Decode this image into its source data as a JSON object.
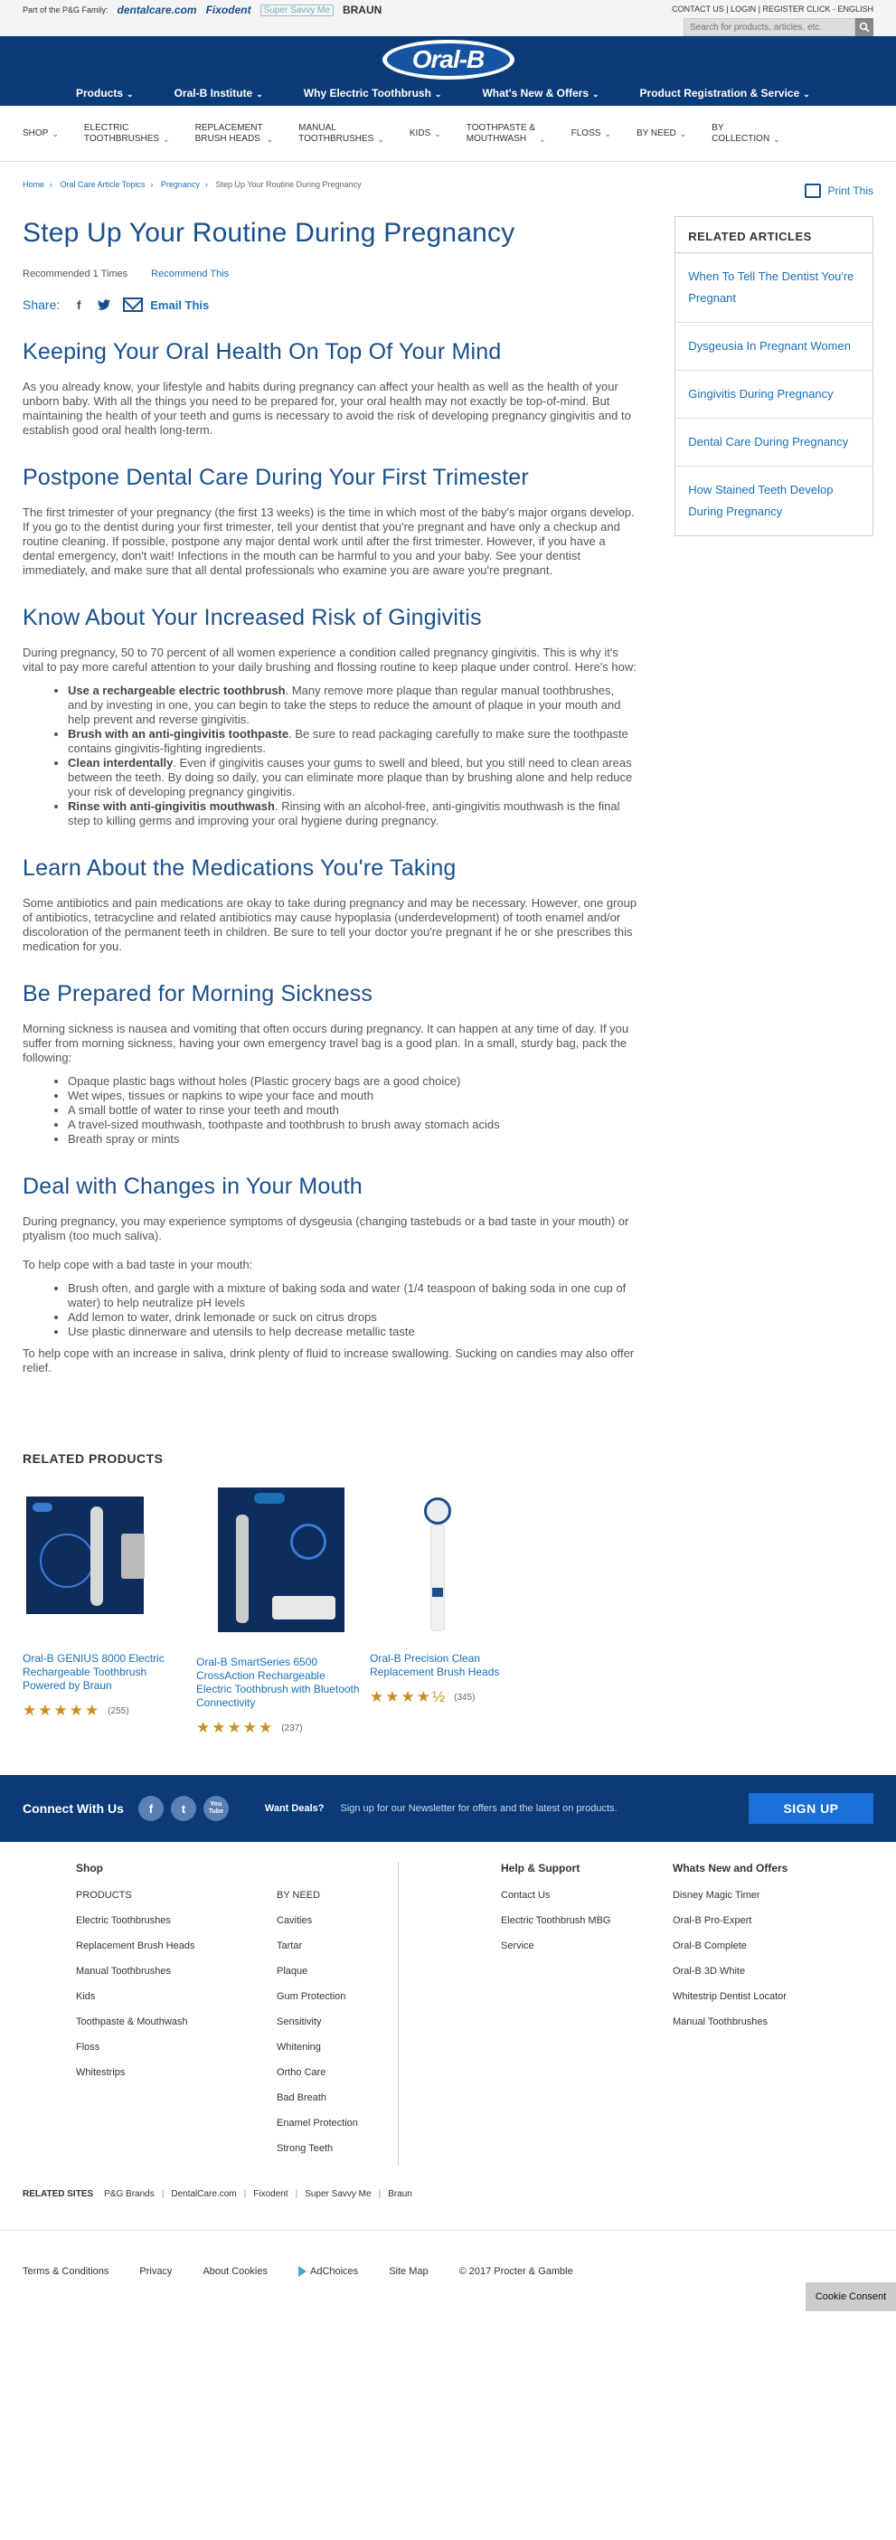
{
  "utility": {
    "family_label": "Part of the P&G Family:",
    "brands": [
      "dentalcare.com",
      "Fixodent",
      "Super Savvy Me",
      "BRAUN"
    ],
    "links": "CONTACT US | LOGIN | REGISTER   CLICK - ENGLISH",
    "search_placeholder": "Search for products, articles, etc."
  },
  "logo": "Oral-B",
  "main_nav": [
    "Products",
    "Oral-B Institute",
    "Why Electric Toothbrush",
    "What's New & Offers",
    "Product Registration & Service"
  ],
  "sub_nav": [
    {
      "l1": "SHOP",
      "l2": ""
    },
    {
      "l1": "ELECTRIC",
      "l2": "TOOTHBRUSHES"
    },
    {
      "l1": "REPLACEMENT",
      "l2": "BRUSH HEADS"
    },
    {
      "l1": "MANUAL",
      "l2": "TOOTHBRUSHES"
    },
    {
      "l1": "KIDS",
      "l2": ""
    },
    {
      "l1": "TOOTHPASTE &",
      "l2": "MOUTHWASH"
    },
    {
      "l1": "FLOSS",
      "l2": ""
    },
    {
      "l1": "BY NEED",
      "l2": ""
    },
    {
      "l1": "BY",
      "l2": "COLLECTION"
    }
  ],
  "breadcrumb": [
    "Home",
    "Oral Care Article Topics",
    "Pregnancy",
    "Step Up Your Routine During Pregnancy"
  ],
  "print_label": "Print This",
  "article": {
    "title": "Step Up Your Routine During Pregnancy",
    "recommended": "Recommended 1 Times",
    "recommend_this": "Recommend This",
    "share_label": "Share:",
    "email_this": "Email This",
    "s1_h": "Keeping Your Oral Health On Top Of Your Mind",
    "s1_p": "As you already know, your lifestyle and habits during pregnancy can affect your health as well as the health of your unborn baby. With all the things you need to be prepared for, your oral health may not exactly be top-of-mind. But maintaining the health of your teeth and gums is necessary to avoid the risk of developing pregnancy gingivitis and to establish good oral health long-term.",
    "s2_h": "Postpone Dental Care During Your First Trimester",
    "s2_p": "The first trimester of your pregnancy (the first 13 weeks) is the time in which most of the baby's major organs develop. If you go to the dentist during your first trimester, tell your dentist that you're pregnant and have only a checkup and routine cleaning. If possible, postpone any major dental work until after the first trimester. However, if you have a dental emergency, don't wait! Infections in the mouth can be harmful to you and your baby. See your dentist immediately, and make sure that all dental professionals who examine you are aware you're pregnant.",
    "s3_h": "Know About Your Increased Risk of Gingivitis",
    "s3_p": "During pregnancy, 50 to 70 percent of all women experience a condition called pregnancy gingivitis. This is why it's vital to pay more careful attention to your daily brushing and flossing routine to keep plaque under control. Here's how:",
    "s3_list": [
      {
        "b": "Use a rechargeable electric toothbrush",
        "t": ". Many remove more plaque than regular manual toothbrushes, and by investing in one, you can begin to take the steps to reduce the amount of plaque in your mouth and help prevent and reverse gingivitis."
      },
      {
        "b": "Brush with an anti-gingivitis toothpaste",
        "t": ". Be sure to read packaging carefully to make sure the toothpaste contains gingivitis-fighting ingredients."
      },
      {
        "b": "Clean interdentally",
        "t": ". Even if gingivitis causes your gums to swell and bleed, but you still need to clean areas between the teeth. By doing so daily, you can eliminate more plaque than by brushing alone and help reduce your risk of developing pregnancy gingivitis."
      },
      {
        "b": "Rinse with anti-gingivitis mouthwash",
        "t": ". Rinsing with an alcohol-free, anti-gingivitis mouthwash is the final step to killing germs and improving your oral hygiene during pregnancy."
      }
    ],
    "s4_h": "Learn About the Medications You're Taking",
    "s4_p": "Some antibiotics and pain medications are okay to take during pregnancy and may be necessary. However, one group of antibiotics, tetracycline and related antibiotics may cause hypoplasia (underdevelopment) of tooth enamel and/or discoloration of the permanent teeth in children. Be sure to tell your doctor you're pregnant if he or she prescribes this medication for you.",
    "s5_h": "Be Prepared for Morning Sickness",
    "s5_p": "Morning sickness is nausea and vomiting that often occurs during pregnancy. It can happen at any time of day. If you suffer from morning sickness, having your own emergency travel bag is a good plan. In a small, sturdy bag, pack the following:",
    "s5_list": [
      "Opaque plastic bags without holes (Plastic grocery bags are a good choice)",
      "Wet wipes, tissues or napkins to wipe your face and mouth",
      "A small bottle of water to rinse your teeth and mouth",
      "A travel-sized mouthwash, toothpaste and toothbrush to brush away stomach acids",
      "Breath spray or mints"
    ],
    "s6_h": "Deal with Changes in Your Mouth",
    "s6_p1": "During pregnancy, you may experience symptoms of dysgeusia (changing tastebuds or a bad taste in your mouth) or ptyalism (too much saliva).",
    "s6_p2": "To help cope with a bad taste in your mouth:",
    "s6_list": [
      "Brush often, and gargle with a mixture of baking soda and water (1/4 teaspoon of baking soda in one cup of water) to help neutralize pH levels",
      "Add lemon to water, drink lemonade or suck on citrus drops",
      "Use plastic dinnerware and utensils to help decrease metallic taste"
    ],
    "s6_p3": "To help cope with an increase in saliva, drink plenty of fluid to increase swallowing. Sucking on candies may also offer relief."
  },
  "related_articles": {
    "heading": "RELATED ARTICLES",
    "items": [
      "When To Tell The Dentist You're Pregnant",
      "Dysgeusia In Pregnant Women",
      "Gingivitis During Pregnancy",
      "Dental Care During Pregnancy",
      "How Stained Teeth Develop During Pregnancy"
    ]
  },
  "related_products": {
    "heading": "RELATED PRODUCTS",
    "items": [
      {
        "name": "Oral-B GENIUS 8000 Electric Rechargeable Toothbrush Powered by Braun",
        "stars": "★★★★★",
        "rating": 5,
        "count": "(255)"
      },
      {
        "name": "Oral-B SmartSeries 6500 CrossAction Rechargeable Electric Toothbrush with Bluetooth Connectivity",
        "stars": "★★★★★",
        "rating": 5,
        "count": "(237)"
      },
      {
        "name": "Oral-B Precision Clean Replacement Brush Heads",
        "stars": "★★★★½",
        "rating": 4.5,
        "count": "(345)"
      }
    ]
  },
  "footer": {
    "connect": "Connect With Us",
    "social": [
      "f",
      "t",
      "You Tube"
    ],
    "deals": "Want Deals?",
    "newsletter": "Sign up for our Newsletter for offers and the latest on products.",
    "signup": "SIGN UP",
    "shop_h": "Shop",
    "shop_col1": [
      "PRODUCTS",
      "Electric Toothbrushes",
      "Replacement Brush Heads",
      "Manual Toothbrushes",
      "Kids",
      "Toothpaste & Mouthwash",
      "Floss",
      "Whitestrips"
    ],
    "shop_col2": [
      "BY NEED",
      "Cavities",
      "Tartar",
      "Plaque",
      "Gum Protection",
      "Sensitivity",
      "Whitening",
      "Ortho Care",
      "Bad Breath",
      "Enamel Protection",
      "Strong Teeth"
    ],
    "help_h": "Help & Support",
    "help": [
      "Contact Us",
      "Electric Toothbrush MBG",
      "Service"
    ],
    "new_h": "Whats New and Offers",
    "new": [
      "Disney Magic Timer",
      "Oral-B Pro-Expert",
      "Oral-B Complete",
      "Oral-B 3D White",
      "Whitestrip Dentist Locator",
      "Manual Toothbrushes"
    ],
    "related_sites_h": "RELATED SITES",
    "related_sites": [
      "P&G Brands",
      "DentalCare.com",
      "Fixodent",
      "Super Savvy Me",
      "Braun"
    ],
    "bottom": [
      "Terms & Conditions",
      "Privacy",
      "About Cookies",
      "AdChoices",
      "Site Map",
      "© 2017 Procter & Gamble"
    ],
    "cookie": "Cookie Consent"
  }
}
